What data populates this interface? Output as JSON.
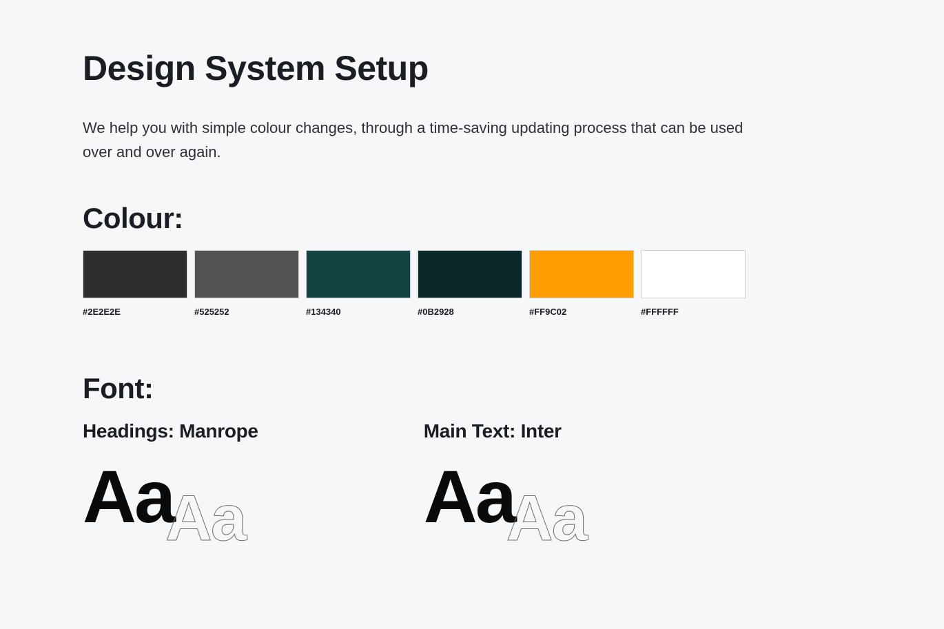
{
  "title": "Design System Setup",
  "description": "We help you with simple colour changes, through a time-saving updating process that can be used over and over again.",
  "colour": {
    "heading": "Colour:",
    "swatches": [
      {
        "hex": "#2E2E2E"
      },
      {
        "hex": "#525252"
      },
      {
        "hex": "#134340"
      },
      {
        "hex": "#0B2928"
      },
      {
        "hex": "#FF9C02"
      },
      {
        "hex": "#FFFFFF"
      }
    ]
  },
  "font": {
    "heading": "Font:",
    "items": [
      {
        "label": "Headings: Manrope",
        "sample_solid": "Aa",
        "sample_outline": "Aa"
      },
      {
        "label": "Main Text: Inter",
        "sample_solid": "Aa",
        "sample_outline": "Aa"
      }
    ]
  }
}
